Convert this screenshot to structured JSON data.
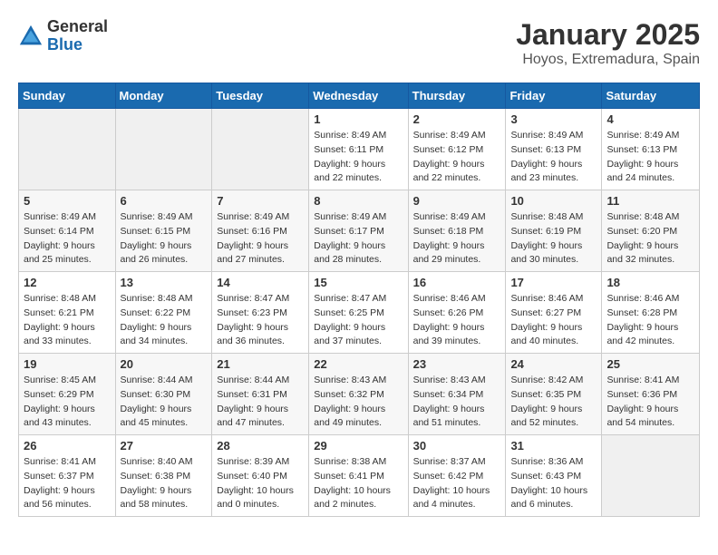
{
  "app": {
    "name_general": "General",
    "name_blue": "Blue"
  },
  "header": {
    "title": "January 2025",
    "subtitle": "Hoyos, Extremadura, Spain"
  },
  "calendar": {
    "weekdays": [
      "Sunday",
      "Monday",
      "Tuesday",
      "Wednesday",
      "Thursday",
      "Friday",
      "Saturday"
    ],
    "weeks": [
      [
        {
          "day": "",
          "sunrise": "",
          "sunset": "",
          "daylight": ""
        },
        {
          "day": "",
          "sunrise": "",
          "sunset": "",
          "daylight": ""
        },
        {
          "day": "",
          "sunrise": "",
          "sunset": "",
          "daylight": ""
        },
        {
          "day": "1",
          "sunrise": "Sunrise: 8:49 AM",
          "sunset": "Sunset: 6:11 PM",
          "daylight": "Daylight: 9 hours and 22 minutes."
        },
        {
          "day": "2",
          "sunrise": "Sunrise: 8:49 AM",
          "sunset": "Sunset: 6:12 PM",
          "daylight": "Daylight: 9 hours and 22 minutes."
        },
        {
          "day": "3",
          "sunrise": "Sunrise: 8:49 AM",
          "sunset": "Sunset: 6:13 PM",
          "daylight": "Daylight: 9 hours and 23 minutes."
        },
        {
          "day": "4",
          "sunrise": "Sunrise: 8:49 AM",
          "sunset": "Sunset: 6:13 PM",
          "daylight": "Daylight: 9 hours and 24 minutes."
        }
      ],
      [
        {
          "day": "5",
          "sunrise": "Sunrise: 8:49 AM",
          "sunset": "Sunset: 6:14 PM",
          "daylight": "Daylight: 9 hours and 25 minutes."
        },
        {
          "day": "6",
          "sunrise": "Sunrise: 8:49 AM",
          "sunset": "Sunset: 6:15 PM",
          "daylight": "Daylight: 9 hours and 26 minutes."
        },
        {
          "day": "7",
          "sunrise": "Sunrise: 8:49 AM",
          "sunset": "Sunset: 6:16 PM",
          "daylight": "Daylight: 9 hours and 27 minutes."
        },
        {
          "day": "8",
          "sunrise": "Sunrise: 8:49 AM",
          "sunset": "Sunset: 6:17 PM",
          "daylight": "Daylight: 9 hours and 28 minutes."
        },
        {
          "day": "9",
          "sunrise": "Sunrise: 8:49 AM",
          "sunset": "Sunset: 6:18 PM",
          "daylight": "Daylight: 9 hours and 29 minutes."
        },
        {
          "day": "10",
          "sunrise": "Sunrise: 8:48 AM",
          "sunset": "Sunset: 6:19 PM",
          "daylight": "Daylight: 9 hours and 30 minutes."
        },
        {
          "day": "11",
          "sunrise": "Sunrise: 8:48 AM",
          "sunset": "Sunset: 6:20 PM",
          "daylight": "Daylight: 9 hours and 32 minutes."
        }
      ],
      [
        {
          "day": "12",
          "sunrise": "Sunrise: 8:48 AM",
          "sunset": "Sunset: 6:21 PM",
          "daylight": "Daylight: 9 hours and 33 minutes."
        },
        {
          "day": "13",
          "sunrise": "Sunrise: 8:48 AM",
          "sunset": "Sunset: 6:22 PM",
          "daylight": "Daylight: 9 hours and 34 minutes."
        },
        {
          "day": "14",
          "sunrise": "Sunrise: 8:47 AM",
          "sunset": "Sunset: 6:23 PM",
          "daylight": "Daylight: 9 hours and 36 minutes."
        },
        {
          "day": "15",
          "sunrise": "Sunrise: 8:47 AM",
          "sunset": "Sunset: 6:25 PM",
          "daylight": "Daylight: 9 hours and 37 minutes."
        },
        {
          "day": "16",
          "sunrise": "Sunrise: 8:46 AM",
          "sunset": "Sunset: 6:26 PM",
          "daylight": "Daylight: 9 hours and 39 minutes."
        },
        {
          "day": "17",
          "sunrise": "Sunrise: 8:46 AM",
          "sunset": "Sunset: 6:27 PM",
          "daylight": "Daylight: 9 hours and 40 minutes."
        },
        {
          "day": "18",
          "sunrise": "Sunrise: 8:46 AM",
          "sunset": "Sunset: 6:28 PM",
          "daylight": "Daylight: 9 hours and 42 minutes."
        }
      ],
      [
        {
          "day": "19",
          "sunrise": "Sunrise: 8:45 AM",
          "sunset": "Sunset: 6:29 PM",
          "daylight": "Daylight: 9 hours and 43 minutes."
        },
        {
          "day": "20",
          "sunrise": "Sunrise: 8:44 AM",
          "sunset": "Sunset: 6:30 PM",
          "daylight": "Daylight: 9 hours and 45 minutes."
        },
        {
          "day": "21",
          "sunrise": "Sunrise: 8:44 AM",
          "sunset": "Sunset: 6:31 PM",
          "daylight": "Daylight: 9 hours and 47 minutes."
        },
        {
          "day": "22",
          "sunrise": "Sunrise: 8:43 AM",
          "sunset": "Sunset: 6:32 PM",
          "daylight": "Daylight: 9 hours and 49 minutes."
        },
        {
          "day": "23",
          "sunrise": "Sunrise: 8:43 AM",
          "sunset": "Sunset: 6:34 PM",
          "daylight": "Daylight: 9 hours and 51 minutes."
        },
        {
          "day": "24",
          "sunrise": "Sunrise: 8:42 AM",
          "sunset": "Sunset: 6:35 PM",
          "daylight": "Daylight: 9 hours and 52 minutes."
        },
        {
          "day": "25",
          "sunrise": "Sunrise: 8:41 AM",
          "sunset": "Sunset: 6:36 PM",
          "daylight": "Daylight: 9 hours and 54 minutes."
        }
      ],
      [
        {
          "day": "26",
          "sunrise": "Sunrise: 8:41 AM",
          "sunset": "Sunset: 6:37 PM",
          "daylight": "Daylight: 9 hours and 56 minutes."
        },
        {
          "day": "27",
          "sunrise": "Sunrise: 8:40 AM",
          "sunset": "Sunset: 6:38 PM",
          "daylight": "Daylight: 9 hours and 58 minutes."
        },
        {
          "day": "28",
          "sunrise": "Sunrise: 8:39 AM",
          "sunset": "Sunset: 6:40 PM",
          "daylight": "Daylight: 10 hours and 0 minutes."
        },
        {
          "day": "29",
          "sunrise": "Sunrise: 8:38 AM",
          "sunset": "Sunset: 6:41 PM",
          "daylight": "Daylight: 10 hours and 2 minutes."
        },
        {
          "day": "30",
          "sunrise": "Sunrise: 8:37 AM",
          "sunset": "Sunset: 6:42 PM",
          "daylight": "Daylight: 10 hours and 4 minutes."
        },
        {
          "day": "31",
          "sunrise": "Sunrise: 8:36 AM",
          "sunset": "Sunset: 6:43 PM",
          "daylight": "Daylight: 10 hours and 6 minutes."
        },
        {
          "day": "",
          "sunrise": "",
          "sunset": "",
          "daylight": ""
        }
      ]
    ]
  }
}
